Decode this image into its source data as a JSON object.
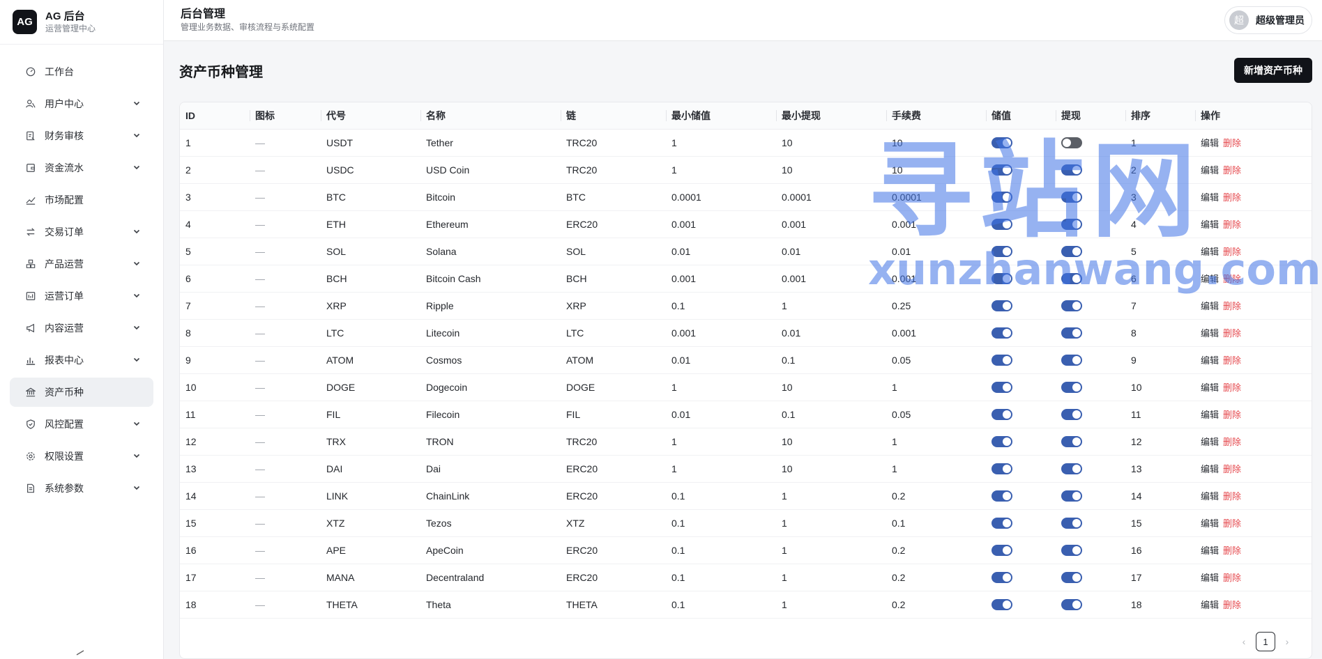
{
  "brand": {
    "logo": "AG",
    "title": "AG 后台",
    "subtitle": "运营管理中心"
  },
  "sidebar": {
    "items": [
      {
        "label": "工作台",
        "icon": "dashboard-icon",
        "expandable": false,
        "active": false
      },
      {
        "label": "用户中心",
        "icon": "users-icon",
        "expandable": true,
        "active": false
      },
      {
        "label": "财务审核",
        "icon": "audit-icon",
        "expandable": true,
        "active": false
      },
      {
        "label": "资金流水",
        "icon": "wallet-icon",
        "expandable": true,
        "active": false
      },
      {
        "label": "市场配置",
        "icon": "chart-line-icon",
        "expandable": false,
        "active": false
      },
      {
        "label": "交易订单",
        "icon": "exchange-icon",
        "expandable": true,
        "active": false
      },
      {
        "label": "产品运营",
        "icon": "boxes-icon",
        "expandable": true,
        "active": false
      },
      {
        "label": "运营订单",
        "icon": "calendar-icon",
        "expandable": true,
        "active": false
      },
      {
        "label": "内容运营",
        "icon": "megaphone-icon",
        "expandable": true,
        "active": false
      },
      {
        "label": "报表中心",
        "icon": "bar-chart-icon",
        "expandable": true,
        "active": false
      },
      {
        "label": "资产币种",
        "icon": "bank-icon",
        "expandable": false,
        "active": true
      },
      {
        "label": "风控配置",
        "icon": "shield-icon",
        "expandable": true,
        "active": false
      },
      {
        "label": "权限设置",
        "icon": "gear-icon",
        "expandable": true,
        "active": false
      },
      {
        "label": "系统参数",
        "icon": "document-icon",
        "expandable": true,
        "active": false
      }
    ]
  },
  "header": {
    "title": "后台管理",
    "subtitle": "管理业务数据、审核流程与系统配置"
  },
  "user": {
    "avatar": "超",
    "name": "超级管理员"
  },
  "page": {
    "title": "资产币种管理",
    "add_button": "新增资产币种"
  },
  "table": {
    "columns": [
      "ID",
      "图标",
      "代号",
      "名称",
      "链",
      "最小储值",
      "最小提现",
      "手续费",
      "储值",
      "提现",
      "排序",
      "操作"
    ],
    "edit_label": "编辑",
    "delete_label": "删除",
    "rows": [
      {
        "id": "1",
        "icon": "—",
        "code": "USDT",
        "name": "Tether",
        "chain": "TRC20",
        "min_deposit": "1",
        "min_withdraw": "10",
        "fee": "10",
        "deposit_on": true,
        "withdraw_on": false,
        "sort": "1"
      },
      {
        "id": "2",
        "icon": "—",
        "code": "USDC",
        "name": "USD Coin",
        "chain": "TRC20",
        "min_deposit": "1",
        "min_withdraw": "10",
        "fee": "10",
        "deposit_on": true,
        "withdraw_on": true,
        "sort": "2"
      },
      {
        "id": "3",
        "icon": "—",
        "code": "BTC",
        "name": "Bitcoin",
        "chain": "BTC",
        "min_deposit": "0.0001",
        "min_withdraw": "0.0001",
        "fee": "0.0001",
        "deposit_on": true,
        "withdraw_on": true,
        "sort": "3"
      },
      {
        "id": "4",
        "icon": "—",
        "code": "ETH",
        "name": "Ethereum",
        "chain": "ERC20",
        "min_deposit": "0.001",
        "min_withdraw": "0.001",
        "fee": "0.001",
        "deposit_on": true,
        "withdraw_on": true,
        "sort": "4"
      },
      {
        "id": "5",
        "icon": "—",
        "code": "SOL",
        "name": "Solana",
        "chain": "SOL",
        "min_deposit": "0.01",
        "min_withdraw": "0.01",
        "fee": "0.01",
        "deposit_on": true,
        "withdraw_on": true,
        "sort": "5"
      },
      {
        "id": "6",
        "icon": "—",
        "code": "BCH",
        "name": "Bitcoin Cash",
        "chain": "BCH",
        "min_deposit": "0.001",
        "min_withdraw": "0.001",
        "fee": "0.001",
        "deposit_on": true,
        "withdraw_on": true,
        "sort": "6"
      },
      {
        "id": "7",
        "icon": "—",
        "code": "XRP",
        "name": "Ripple",
        "chain": "XRP",
        "min_deposit": "0.1",
        "min_withdraw": "1",
        "fee": "0.25",
        "deposit_on": true,
        "withdraw_on": true,
        "sort": "7"
      },
      {
        "id": "8",
        "icon": "—",
        "code": "LTC",
        "name": "Litecoin",
        "chain": "LTC",
        "min_deposit": "0.001",
        "min_withdraw": "0.01",
        "fee": "0.001",
        "deposit_on": true,
        "withdraw_on": true,
        "sort": "8"
      },
      {
        "id": "9",
        "icon": "—",
        "code": "ATOM",
        "name": "Cosmos",
        "chain": "ATOM",
        "min_deposit": "0.01",
        "min_withdraw": "0.1",
        "fee": "0.05",
        "deposit_on": true,
        "withdraw_on": true,
        "sort": "9"
      },
      {
        "id": "10",
        "icon": "—",
        "code": "DOGE",
        "name": "Dogecoin",
        "chain": "DOGE",
        "min_deposit": "1",
        "min_withdraw": "10",
        "fee": "1",
        "deposit_on": true,
        "withdraw_on": true,
        "sort": "10"
      },
      {
        "id": "11",
        "icon": "—",
        "code": "FIL",
        "name": "Filecoin",
        "chain": "FIL",
        "min_deposit": "0.01",
        "min_withdraw": "0.1",
        "fee": "0.05",
        "deposit_on": true,
        "withdraw_on": true,
        "sort": "11"
      },
      {
        "id": "12",
        "icon": "—",
        "code": "TRX",
        "name": "TRON",
        "chain": "TRC20",
        "min_deposit": "1",
        "min_withdraw": "10",
        "fee": "1",
        "deposit_on": true,
        "withdraw_on": true,
        "sort": "12"
      },
      {
        "id": "13",
        "icon": "—",
        "code": "DAI",
        "name": "Dai",
        "chain": "ERC20",
        "min_deposit": "1",
        "min_withdraw": "10",
        "fee": "1",
        "deposit_on": true,
        "withdraw_on": true,
        "sort": "13"
      },
      {
        "id": "14",
        "icon": "—",
        "code": "LINK",
        "name": "ChainLink",
        "chain": "ERC20",
        "min_deposit": "0.1",
        "min_withdraw": "1",
        "fee": "0.2",
        "deposit_on": true,
        "withdraw_on": true,
        "sort": "14"
      },
      {
        "id": "15",
        "icon": "—",
        "code": "XTZ",
        "name": "Tezos",
        "chain": "XTZ",
        "min_deposit": "0.1",
        "min_withdraw": "1",
        "fee": "0.1",
        "deposit_on": true,
        "withdraw_on": true,
        "sort": "15"
      },
      {
        "id": "16",
        "icon": "—",
        "code": "APE",
        "name": "ApeCoin",
        "chain": "ERC20",
        "min_deposit": "0.1",
        "min_withdraw": "1",
        "fee": "0.2",
        "deposit_on": true,
        "withdraw_on": true,
        "sort": "16"
      },
      {
        "id": "17",
        "icon": "—",
        "code": "MANA",
        "name": "Decentraland",
        "chain": "ERC20",
        "min_deposit": "0.1",
        "min_withdraw": "1",
        "fee": "0.2",
        "deposit_on": true,
        "withdraw_on": true,
        "sort": "17"
      },
      {
        "id": "18",
        "icon": "—",
        "code": "THETA",
        "name": "Theta",
        "chain": "THETA",
        "min_deposit": "0.1",
        "min_withdraw": "1",
        "fee": "0.2",
        "deposit_on": true,
        "withdraw_on": true,
        "sort": "18"
      }
    ]
  },
  "pagination": {
    "current": "1",
    "prev": "‹",
    "next": "›"
  },
  "watermark": {
    "main": "寻站网",
    "sub": "xunzhanwang.com"
  },
  "colors": {
    "primary": "#111318",
    "danger": "#e5484d",
    "active_menu": "#eef0f3",
    "switch_on": "#3a5fb0",
    "switch_off": "#5b5f66",
    "watermark": "#3f72e6"
  }
}
